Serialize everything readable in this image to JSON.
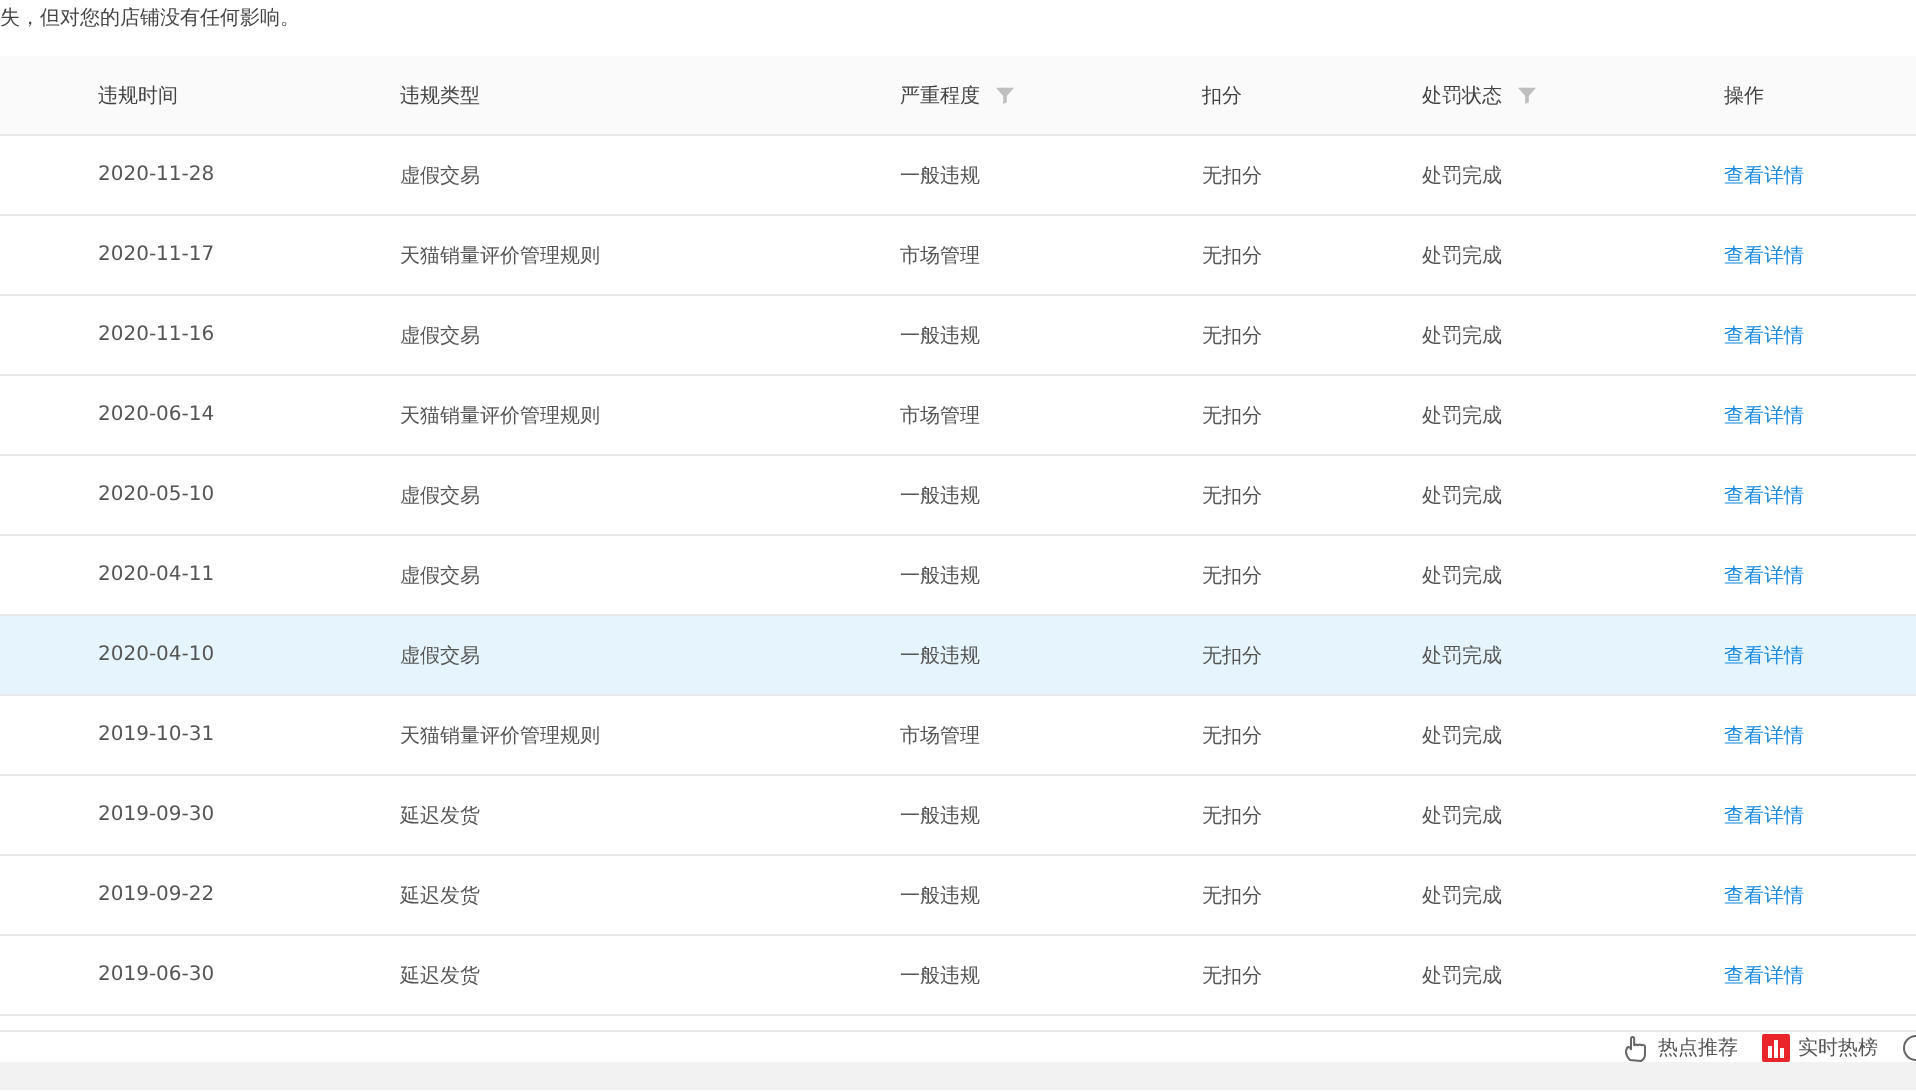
{
  "notice": "失，但对您的店铺没有任何影响。",
  "table": {
    "columns": [
      {
        "label": "违规时间"
      },
      {
        "label": "违规类型"
      },
      {
        "label": "严重程度",
        "filterable": true
      },
      {
        "label": "扣分"
      },
      {
        "label": "处罚状态",
        "filterable": true
      },
      {
        "label": "操作"
      }
    ],
    "rows": [
      {
        "date": "2020-11-28",
        "type": "虚假交易",
        "severity": "一般违规",
        "points": "无扣分",
        "status": "处罚完成",
        "action": "查看详情",
        "selected": false
      },
      {
        "date": "2020-11-17",
        "type": "天猫销量评价管理规则",
        "severity": "市场管理",
        "points": "无扣分",
        "status": "处罚完成",
        "action": "查看详情",
        "selected": false
      },
      {
        "date": "2020-11-16",
        "type": "虚假交易",
        "severity": "一般违规",
        "points": "无扣分",
        "status": "处罚完成",
        "action": "查看详情",
        "selected": false
      },
      {
        "date": "2020-06-14",
        "type": "天猫销量评价管理规则",
        "severity": "市场管理",
        "points": "无扣分",
        "status": "处罚完成",
        "action": "查看详情",
        "selected": false
      },
      {
        "date": "2020-05-10",
        "type": "虚假交易",
        "severity": "一般违规",
        "points": "无扣分",
        "status": "处罚完成",
        "action": "查看详情",
        "selected": false
      },
      {
        "date": "2020-04-11",
        "type": "虚假交易",
        "severity": "一般违规",
        "points": "无扣分",
        "status": "处罚完成",
        "action": "查看详情",
        "selected": false
      },
      {
        "date": "2020-04-10",
        "type": "虚假交易",
        "severity": "一般违规",
        "points": "无扣分",
        "status": "处罚完成",
        "action": "查看详情",
        "selected": true
      },
      {
        "date": "2019-10-31",
        "type": "天猫销量评价管理规则",
        "severity": "市场管理",
        "points": "无扣分",
        "status": "处罚完成",
        "action": "查看详情",
        "selected": false
      },
      {
        "date": "2019-09-30",
        "type": "延迟发货",
        "severity": "一般违规",
        "points": "无扣分",
        "status": "处罚完成",
        "action": "查看详情",
        "selected": false
      },
      {
        "date": "2019-09-22",
        "type": "延迟发货",
        "severity": "一般违规",
        "points": "无扣分",
        "status": "处罚完成",
        "action": "查看详情",
        "selected": false
      },
      {
        "date": "2019-06-30",
        "type": "延迟发货",
        "severity": "一般违规",
        "points": "无扣分",
        "status": "处罚完成",
        "action": "查看详情",
        "selected": false
      }
    ]
  },
  "footer": {
    "items": [
      {
        "kind": "hot",
        "label": "热点推荐"
      },
      {
        "kind": "chart",
        "label": "实时热榜"
      }
    ]
  }
}
